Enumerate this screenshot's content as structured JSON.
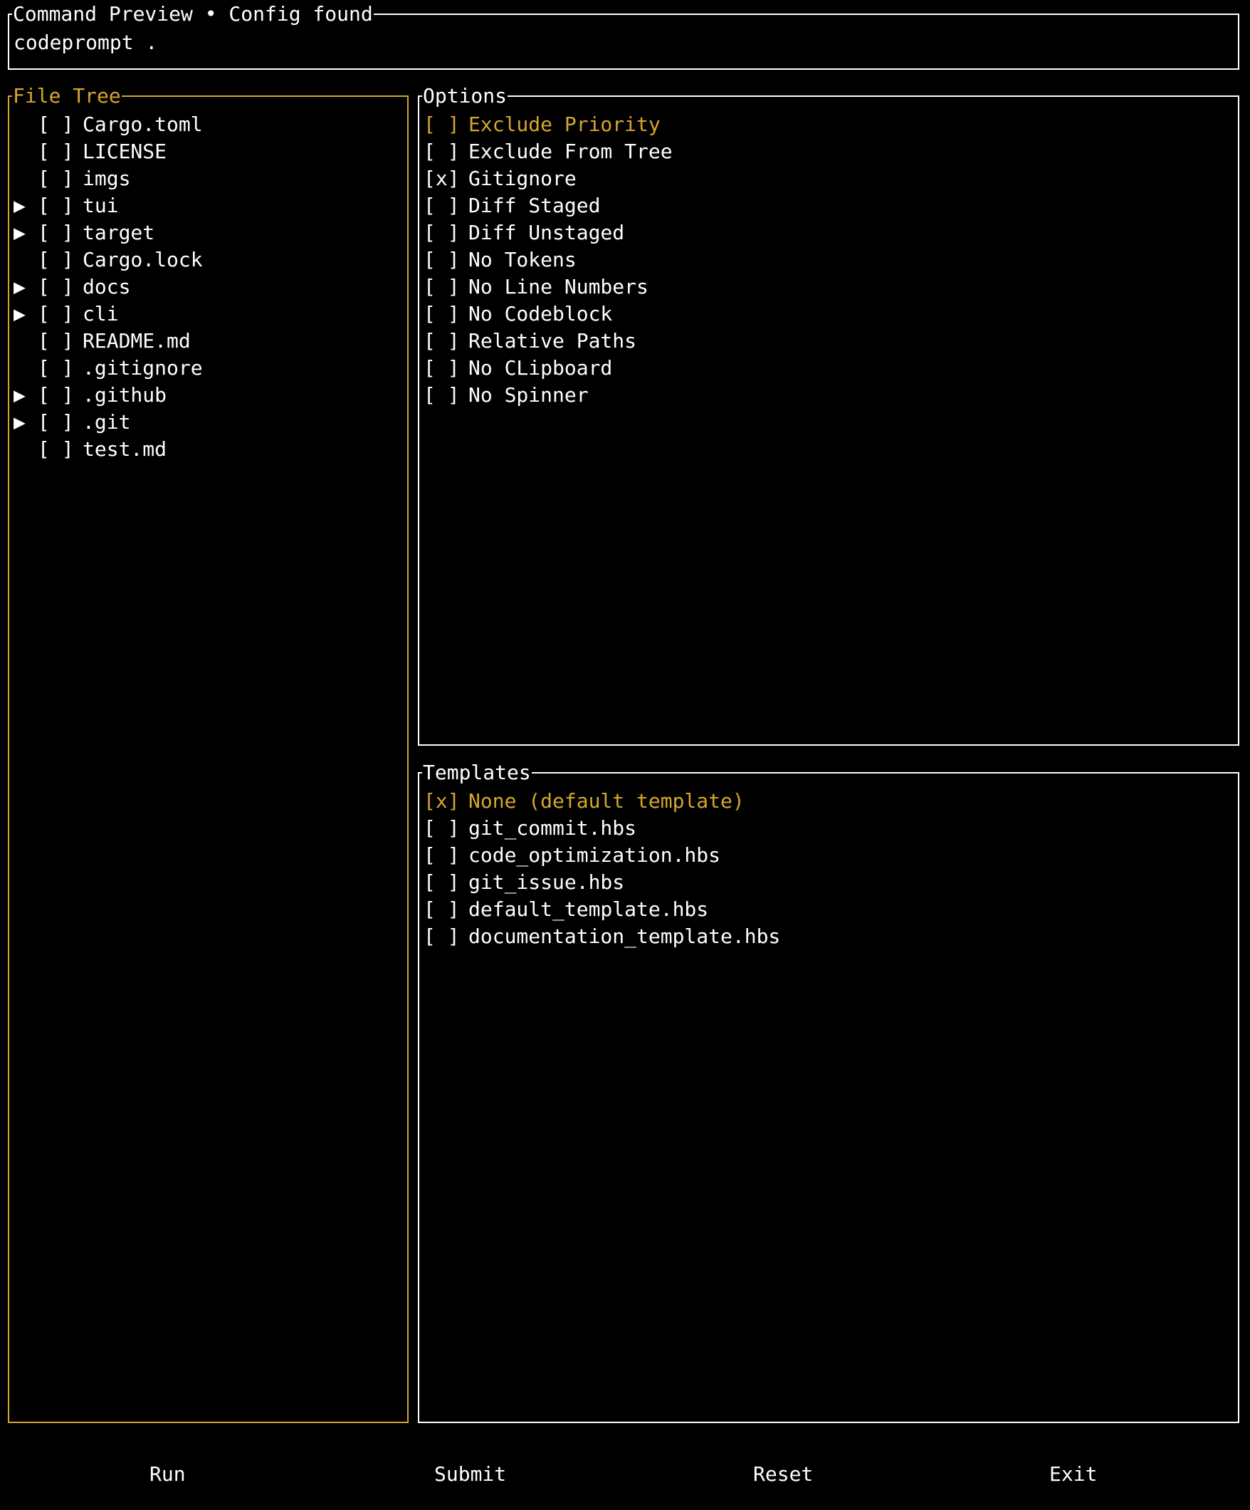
{
  "command_preview": {
    "title": "Command Preview • Config found",
    "command": "codeprompt ."
  },
  "file_tree": {
    "title": "File Tree",
    "items": [
      {
        "arrow": "",
        "check": "[ ]",
        "name": "Cargo.toml"
      },
      {
        "arrow": "",
        "check": "[ ]",
        "name": "LICENSE"
      },
      {
        "arrow": "",
        "check": "[ ]",
        "name": "imgs"
      },
      {
        "arrow": "▶",
        "check": "[ ]",
        "name": "tui"
      },
      {
        "arrow": "▶",
        "check": "[ ]",
        "name": "target"
      },
      {
        "arrow": "",
        "check": "[ ]",
        "name": "Cargo.lock"
      },
      {
        "arrow": "▶",
        "check": "[ ]",
        "name": "docs"
      },
      {
        "arrow": "▶",
        "check": "[ ]",
        "name": "cli"
      },
      {
        "arrow": "",
        "check": "[ ]",
        "name": "README.md"
      },
      {
        "arrow": "",
        "check": "[ ]",
        "name": ".gitignore"
      },
      {
        "arrow": "▶",
        "check": "[ ]",
        "name": ".github"
      },
      {
        "arrow": "▶",
        "check": "[ ]",
        "name": ".git"
      },
      {
        "arrow": "",
        "check": "[ ]",
        "name": "test.md"
      }
    ]
  },
  "options": {
    "title": "Options",
    "items": [
      {
        "check": "[ ]",
        "label": "Exclude Priority"
      },
      {
        "check": "[ ]",
        "label": "Exclude From Tree"
      },
      {
        "check": "[x]",
        "label": "Gitignore"
      },
      {
        "check": "[ ]",
        "label": "Diff Staged"
      },
      {
        "check": "[ ]",
        "label": "Diff Unstaged"
      },
      {
        "check": "[ ]",
        "label": "No Tokens"
      },
      {
        "check": "[ ]",
        "label": "No Line Numbers"
      },
      {
        "check": "[ ]",
        "label": "No Codeblock"
      },
      {
        "check": "[ ]",
        "label": "Relative Paths"
      },
      {
        "check": "[ ]",
        "label": "No CLipboard"
      },
      {
        "check": "[ ]",
        "label": "No Spinner"
      }
    ]
  },
  "templates": {
    "title": "Templates",
    "items": [
      {
        "check": "[x]",
        "label": "None (default template)"
      },
      {
        "check": "[ ]",
        "label": "git_commit.hbs"
      },
      {
        "check": "[ ]",
        "label": "code_optimization.hbs"
      },
      {
        "check": "[ ]",
        "label": "git_issue.hbs"
      },
      {
        "check": "[ ]",
        "label": "default_template.hbs"
      },
      {
        "check": "[ ]",
        "label": "documentation_template.hbs"
      }
    ]
  },
  "footer": {
    "run": "Run",
    "submit": "Submit",
    "reset": "Reset",
    "exit": "Exit"
  },
  "colors": {
    "background": "#000000",
    "text": "#ffffff",
    "accent": "#d4a72c"
  }
}
